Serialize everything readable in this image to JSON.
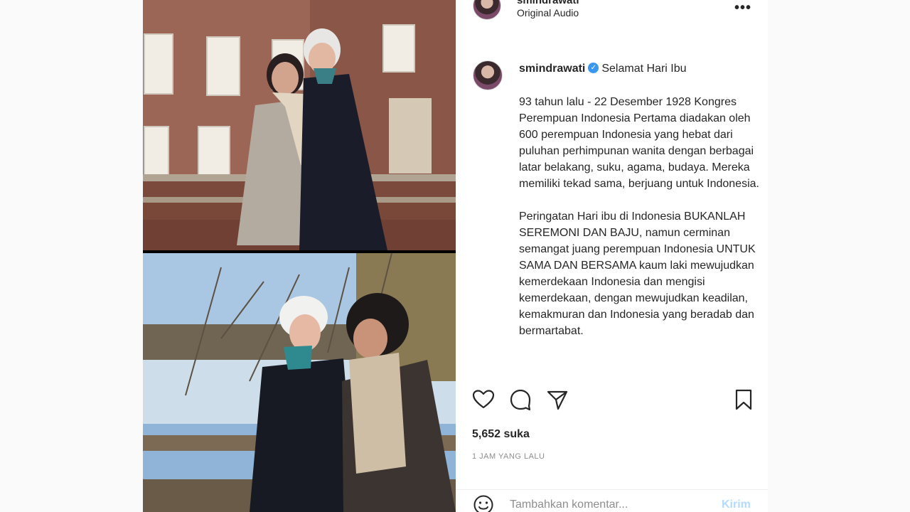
{
  "header": {
    "username": "smindrawati",
    "audio": "Original Audio"
  },
  "caption": {
    "username": "smindrawati",
    "first_line": "Selamat Hari Ibu",
    "paragraphs": [
      "93 tahun lalu - 22 Desember 1928 Kongres Perempuan Indonesia Pertama diadakan oleh 600 perempuan Indonesia yang hebat dari puluhan perhimpunan wanita dengan berbagai latar belakang, suku, agama, budaya. Mereka memiliki tekad sama, berjuang untuk Indonesia.",
      "Peringatan Hari ibu di Indonesia BUKANLAH SEREMONI DAN BAJU, namun cerminan semangat juang perempuan Indonesia UNTUK SAMA DAN BERSAMA kaum laki mewujudkan kemerdekaan Indonesia dan mengisi kemerdekaan, dengan mewujudkan keadilan, kemakmuran dan Indonesia yang beradab dan bermartabat."
    ]
  },
  "likes": "5,652 suka",
  "time": "1 JAM YANG LALU",
  "comment": {
    "placeholder": "Tambahkan komentar...",
    "post_label": "Kirim"
  },
  "icons": {
    "more": "more-options-icon",
    "like": "heart-icon",
    "comment": "comment-icon",
    "share": "send-icon",
    "save": "bookmark-icon",
    "emoji": "emoji-icon",
    "verified": "verified-badge-icon"
  },
  "colors": {
    "verified": "#3897f0",
    "post_button_disabled": "#b3dbff",
    "muted": "#8e8e8e"
  }
}
